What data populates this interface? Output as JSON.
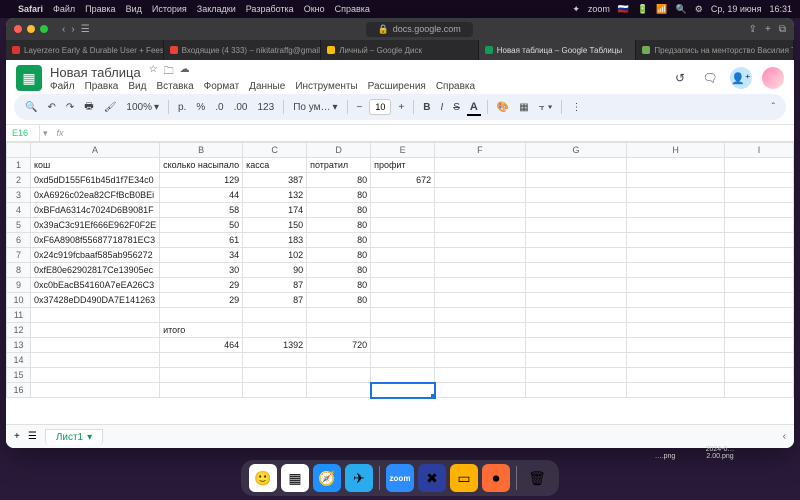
{
  "macos": {
    "app_name": "Safari",
    "menu": [
      "Файл",
      "Правка",
      "Вид",
      "История",
      "Закладки",
      "Разработка",
      "Окно",
      "Справка"
    ],
    "right": {
      "zoom": "zoom",
      "flag": "🇷🇺",
      "date": "Ср, 19 июня",
      "time": "16:31"
    }
  },
  "browser": {
    "url": "docs.google.com",
    "tabs": [
      {
        "label": "Layerzero Early & Durable User + Fees S…",
        "color": "#d33"
      },
      {
        "label": "Входящие (4 333) – nikitatraffg@gmail.c…",
        "color": "#ea4335"
      },
      {
        "label": "Личный – Google Диск",
        "color": "#fbbc04"
      },
      {
        "label": "Новая таблица – Google Таблицы",
        "color": "#0f9d58",
        "active": true
      },
      {
        "label": "Предзапись на менторство Василия Ти…",
        "color": "#7a5"
      }
    ]
  },
  "sheets": {
    "title": "Новая таблица",
    "menu": [
      "Файл",
      "Правка",
      "Вид",
      "Вставка",
      "Формат",
      "Данные",
      "Инструменты",
      "Расширения",
      "Справка"
    ],
    "toolbar": {
      "zoom": "100%",
      "currency": "р.",
      "pct": "%",
      "dec_dec": ".0",
      "dec_inc": ".00",
      "format_num": "123",
      "font": "По ум…",
      "font_size": "10"
    },
    "name_box": "E16",
    "fx": "fx",
    "columns": [
      "A",
      "B",
      "C",
      "D",
      "E",
      "F",
      "G",
      "H",
      "I"
    ],
    "headers": {
      "A": "кош",
      "B": "сколько насыпало",
      "C": "касса",
      "D": "потратил",
      "E": "профит"
    },
    "rows": [
      {
        "A": "0xd5dD155F61b45d1f7E34c0",
        "B": "129",
        "C": "387",
        "D": "80",
        "E": "672"
      },
      {
        "A": "0xA6926c02ea82CFfBcB0BEi",
        "B": "44",
        "C": "132",
        "D": "80",
        "E": ""
      },
      {
        "A": "0xBFdA6314c7024D6B9081F",
        "B": "58",
        "C": "174",
        "D": "80",
        "E": ""
      },
      {
        "A": "0x39aC3c91Ef666E962F0F2E",
        "B": "50",
        "C": "150",
        "D": "80",
        "E": ""
      },
      {
        "A": "0xF6A8908f55687718781EC3",
        "B": "61",
        "C": "183",
        "D": "80",
        "E": ""
      },
      {
        "A": "0x24c919fcbaaf585ab956272",
        "B": "34",
        "C": "102",
        "D": "80",
        "E": ""
      },
      {
        "A": "0xfE80e62902817Ce13905ec",
        "B": "30",
        "C": "90",
        "D": "80",
        "E": ""
      },
      {
        "A": "0xc0bEacB54160A7eEA26C3",
        "B": "29",
        "C": "87",
        "D": "80",
        "E": ""
      },
      {
        "A": "0x37428eDD490DA7E141263",
        "B": "29",
        "C": "87",
        "D": "80",
        "E": ""
      }
    ],
    "total_label": "итого",
    "totals": {
      "B": "464",
      "C": "1392",
      "D": "720"
    },
    "selected": "E16",
    "sheet_tab": "Лист1"
  },
  "desktop": {
    "file1": "….png",
    "file2": "2024-0… 2.00.png"
  }
}
